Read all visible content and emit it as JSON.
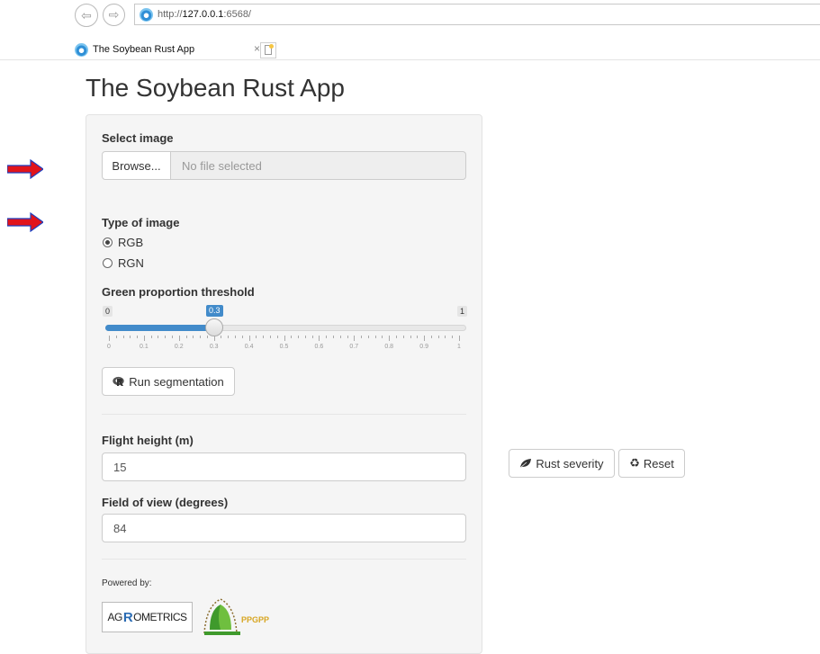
{
  "browser": {
    "url_scheme": "http://",
    "url_host": "127.0.0.1",
    "url_tail": ":6568/",
    "tab_title": "The Soybean Rust App",
    "tab_close": "×"
  },
  "page": {
    "title": "The Soybean Rust App"
  },
  "image_input": {
    "label": "Select image",
    "browse_label": "Browse...",
    "file_status": "No file selected"
  },
  "image_type": {
    "label": "Type of image",
    "options": [
      "RGB",
      "RGN"
    ],
    "selected": "RGB"
  },
  "threshold": {
    "label": "Green proportion threshold",
    "min_label": "0",
    "max_label": "1",
    "value_label": "0.3",
    "value": 0.3,
    "min": 0,
    "max": 1,
    "ticks": [
      "0",
      "0.1",
      "0.2",
      "0.3",
      "0.4",
      "0.5",
      "0.6",
      "0.7",
      "0.8",
      "0.9",
      "1"
    ]
  },
  "segmentation": {
    "run_label": "Run segmentation"
  },
  "flight": {
    "height_label": "Flight height (m)",
    "height_value": "15",
    "fov_label": "Field of view (degrees)",
    "fov_value": "84"
  },
  "actions": {
    "rust_label": "Rust severity",
    "reset_label": "Reset"
  },
  "footer": {
    "powered_by": "Powered by:",
    "logo1_text_a": "AG",
    "logo1_text_r": "R",
    "logo1_text_b": "OMETRICS",
    "logo2_text": "PPGPP"
  },
  "colors": {
    "accent": "#428bca",
    "arrow": "#e1141b"
  }
}
